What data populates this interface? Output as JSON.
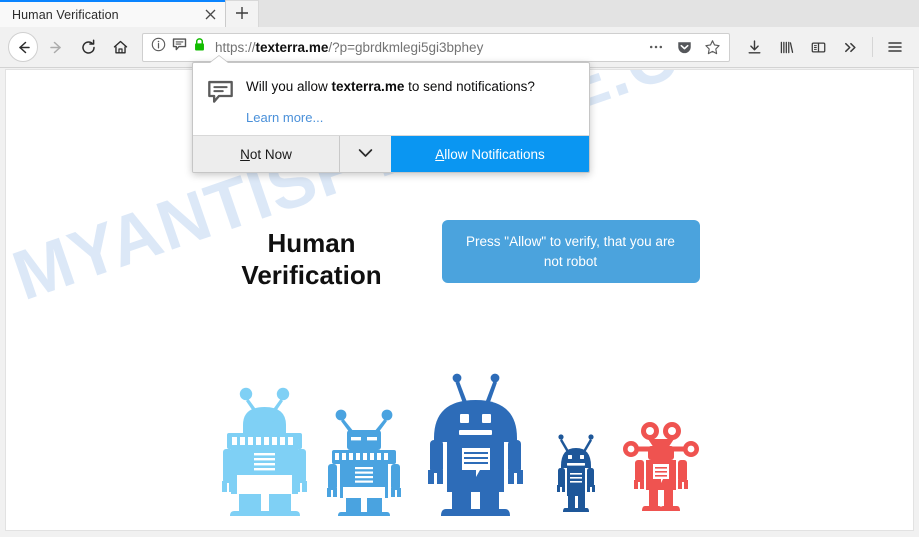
{
  "browser": {
    "tab": {
      "title": "Human Verification",
      "close_icon": "close-icon",
      "newtab_icon": "plus-icon"
    },
    "nav": {
      "back_icon": "back-arrow-icon",
      "forward_icon": "forward-arrow-icon",
      "reload_icon": "reload-icon",
      "home_icon": "home-icon"
    },
    "urlbar": {
      "identity_icon": "info-circle-icon",
      "notification_permission_icon": "speech-bubble-icon",
      "lock_icon": "padlock-icon",
      "url_scheme": "https://",
      "url_domain": "texterra.me",
      "url_path": "/?p=gbrdkmlegi5gi3bphey",
      "page_actions_icon": "ellipsis-icon",
      "pocket_icon": "pocket-shield-icon",
      "bookmark_icon": "star-icon"
    },
    "toolbar": {
      "downloads_icon": "download-arrow-icon",
      "library_icon": "library-icon",
      "sidebar_icon": "sidebar-icon",
      "overflow_icon": "double-chevron-right-icon",
      "menu_icon": "hamburger-menu-icon"
    }
  },
  "doorhanger": {
    "icon": "speech-bubble-icon",
    "question_prefix": "Will you allow ",
    "question_domain": "texterra.me",
    "question_suffix": " to send notifications?",
    "learn_more": "Learn more...",
    "not_now_label": "Not Now",
    "not_now_accesskey": "N",
    "dropmarker_icon": "chevron-down-icon",
    "allow_label": "Allow Notifications",
    "allow_accesskey": "A",
    "primary_color": "#0a96f2",
    "secondary_color": "#ededed"
  },
  "page": {
    "watermark": "MYANTISPYWARE.COM",
    "watermark_color": "#cfe0f5",
    "heading_line1": "Human",
    "heading_line2": "Verification",
    "tooltip_text": "Press \"Allow\" to verify, that you are not robot",
    "tooltip_color": "#4ba3dd",
    "robots": [
      {
        "name": "robot-light-blue",
        "color": "#7fd0f5"
      },
      {
        "name": "robot-medium-blue",
        "color": "#4aa3e0"
      },
      {
        "name": "robot-large-blue",
        "color": "#2d6cb8"
      },
      {
        "name": "robot-small-navy",
        "color": "#1e5799"
      },
      {
        "name": "robot-red",
        "color": "#ef5350"
      }
    ]
  }
}
